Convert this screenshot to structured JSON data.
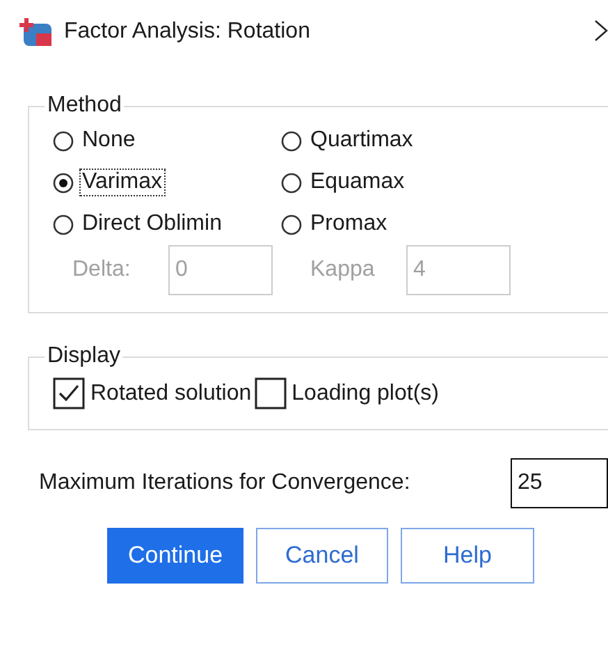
{
  "window": {
    "title": "Factor Analysis: Rotation"
  },
  "method": {
    "title": "Method",
    "options": [
      {
        "label": "None",
        "selected": false,
        "focused": false
      },
      {
        "label": "Quartimax",
        "selected": false,
        "focused": false
      },
      {
        "label": "Varimax",
        "selected": true,
        "focused": true
      },
      {
        "label": "Equamax",
        "selected": false,
        "focused": false
      },
      {
        "label": "Direct Oblimin",
        "selected": false,
        "focused": false
      },
      {
        "label": "Promax",
        "selected": false,
        "focused": false
      }
    ],
    "parameters": [
      {
        "label": "Delta:",
        "value": "0",
        "disabled": true
      },
      {
        "label": "Kappa",
        "value": "4",
        "disabled": true
      }
    ]
  },
  "display": {
    "title": "Display",
    "options": [
      {
        "label": "Rotated solution",
        "checked": true
      },
      {
        "label": "Loading plot(s)",
        "checked": false
      }
    ]
  },
  "max_iterations": {
    "label": "Maximum Iterations for Convergence:",
    "value": "25"
  },
  "buttons": [
    {
      "label": "Continue",
      "default": true
    },
    {
      "label": "Cancel",
      "default": false
    },
    {
      "label": "Help",
      "default": false
    }
  ]
}
